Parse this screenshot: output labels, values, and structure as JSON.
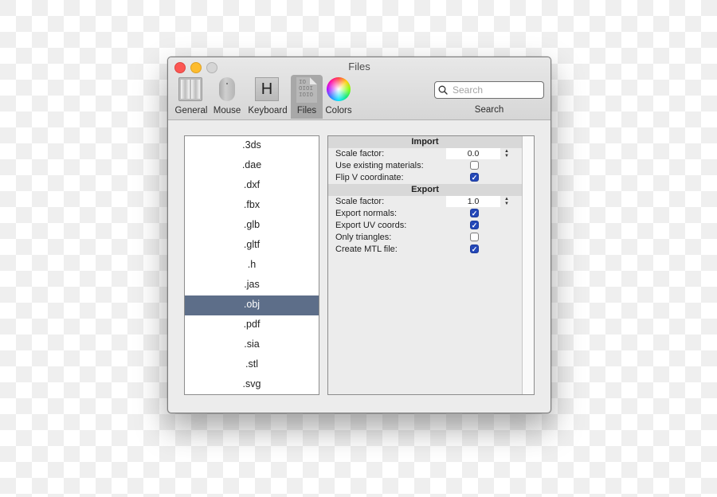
{
  "window": {
    "title": "Files"
  },
  "toolbar": {
    "items": [
      {
        "label": "General",
        "icon": "general-icon"
      },
      {
        "label": "Mouse",
        "icon": "mouse-icon"
      },
      {
        "label": "Keyboard",
        "icon": "keyboard-icon",
        "glyph": "H"
      },
      {
        "label": "Files",
        "icon": "files-icon",
        "glyph": "IO\nOIOI\nIOIO",
        "active": true
      },
      {
        "label": "Colors",
        "icon": "colors-icon"
      }
    ],
    "search": {
      "placeholder": "Search",
      "value": "",
      "caption": "Search",
      "icon": "search-icon"
    }
  },
  "file_types": {
    "items": [
      ".3ds",
      ".dae",
      ".dxf",
      ".fbx",
      ".glb",
      ".gltf",
      ".h",
      ".jas",
      ".obj",
      ".pdf",
      ".sia",
      ".stl",
      ".svg"
    ],
    "selected": ".obj",
    "selected_color": "#5d6e89"
  },
  "options": {
    "import": {
      "header": "Import",
      "rows": [
        {
          "label": "Scale factor:",
          "type": "number",
          "value": "0.0"
        },
        {
          "label": "Use existing materials:",
          "type": "checkbox",
          "checked": false
        },
        {
          "label": "Flip V coordinate:",
          "type": "checkbox",
          "checked": true
        }
      ]
    },
    "export": {
      "header": "Export",
      "rows": [
        {
          "label": "Scale factor:",
          "type": "number",
          "value": "1.0"
        },
        {
          "label": "Export normals:",
          "type": "checkbox",
          "checked": true
        },
        {
          "label": "Export UV coords:",
          "type": "checkbox",
          "checked": true
        },
        {
          "label": "Only triangles:",
          "type": "checkbox",
          "checked": false
        },
        {
          "label": "Create MTL file:",
          "type": "checkbox",
          "checked": true
        }
      ]
    },
    "checkbox_color": "#2448b8"
  }
}
